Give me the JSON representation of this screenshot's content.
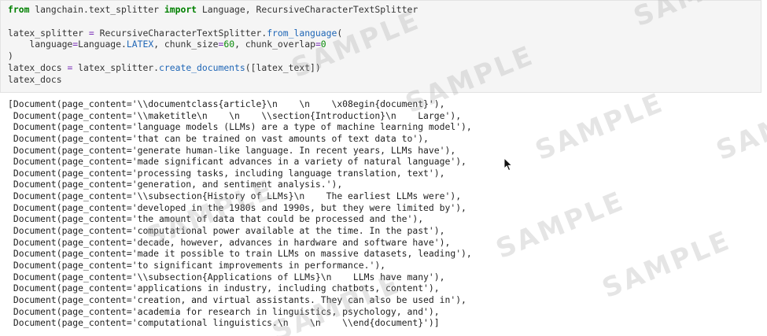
{
  "code_cell": {
    "import_kw_from": "from",
    "import_module": " langchain.text_splitter ",
    "import_kw_import": "import",
    "import_names": " Language, RecursiveCharacterTextSplitter",
    "l3_a": "latex_splitter ",
    "l3_eq": "=",
    "l3_b": " RecursiveCharacterTextSplitter.",
    "l3_fn": "from_language",
    "l3_c": "(",
    "l4_a": "    language",
    "l4_eq1": "=",
    "l4_b": "Language.",
    "l4_enum": "LATEX",
    "l4_c": ", chunk_size",
    "l4_eq2": "=",
    "l4_n1": "60",
    "l4_d": ", chunk_overlap",
    "l4_eq3": "=",
    "l4_n2": "0",
    "l5": ")",
    "l6_a": "latex_docs ",
    "l6_eq": "=",
    "l6_b": " latex_splitter.",
    "l6_fn": "create_documents",
    "l6_c": "([latex_text])",
    "l7": "latex_docs"
  },
  "output_lines": [
    "[Document(page_content='\\\\documentclass{article}\\n    \\n    \\x08egin{document}'),",
    " Document(page_content='\\\\maketitle\\n    \\n    \\\\section{Introduction}\\n    Large'),",
    " Document(page_content='language models (LLMs) are a type of machine learning model'),",
    " Document(page_content='that can be trained on vast amounts of text data to'),",
    " Document(page_content='generate human-like language. In recent years, LLMs have'),",
    " Document(page_content='made significant advances in a variety of natural language'),",
    " Document(page_content='processing tasks, including language translation, text'),",
    " Document(page_content='generation, and sentiment analysis.'),",
    " Document(page_content='\\\\subsection{History of LLMs}\\n    The earliest LLMs were'),",
    " Document(page_content='developed in the 1980s and 1990s, but they were limited by'),",
    " Document(page_content='the amount of data that could be processed and the'),",
    " Document(page_content='computational power available at the time. In the past'),",
    " Document(page_content='decade, however, advances in hardware and software have'),",
    " Document(page_content='made it possible to train LLMs on massive datasets, leading'),",
    " Document(page_content='to significant improvements in performance.'),",
    " Document(page_content='\\\\subsection{Applications of LLMs}\\n    LLMs have many'),",
    " Document(page_content='applications in industry, including chatbots, content'),",
    " Document(page_content='creation, and virtual assistants. They can also be used in'),",
    " Document(page_content='academia for research in linguistics, psychology, and'),",
    " Document(page_content='computational linguistics.\\n    \\n    \\\\end{document}')]"
  ],
  "watermark": {
    "text": "SAMPLE"
  },
  "icons": {
    "cursor": "mouse-pointer-icon"
  },
  "colors": {
    "keyword": "#008000",
    "function": "#1f66b6",
    "number": "#0a8a0a",
    "operator": "#7a2fb8",
    "cell_bg": "#f5f5f5"
  }
}
